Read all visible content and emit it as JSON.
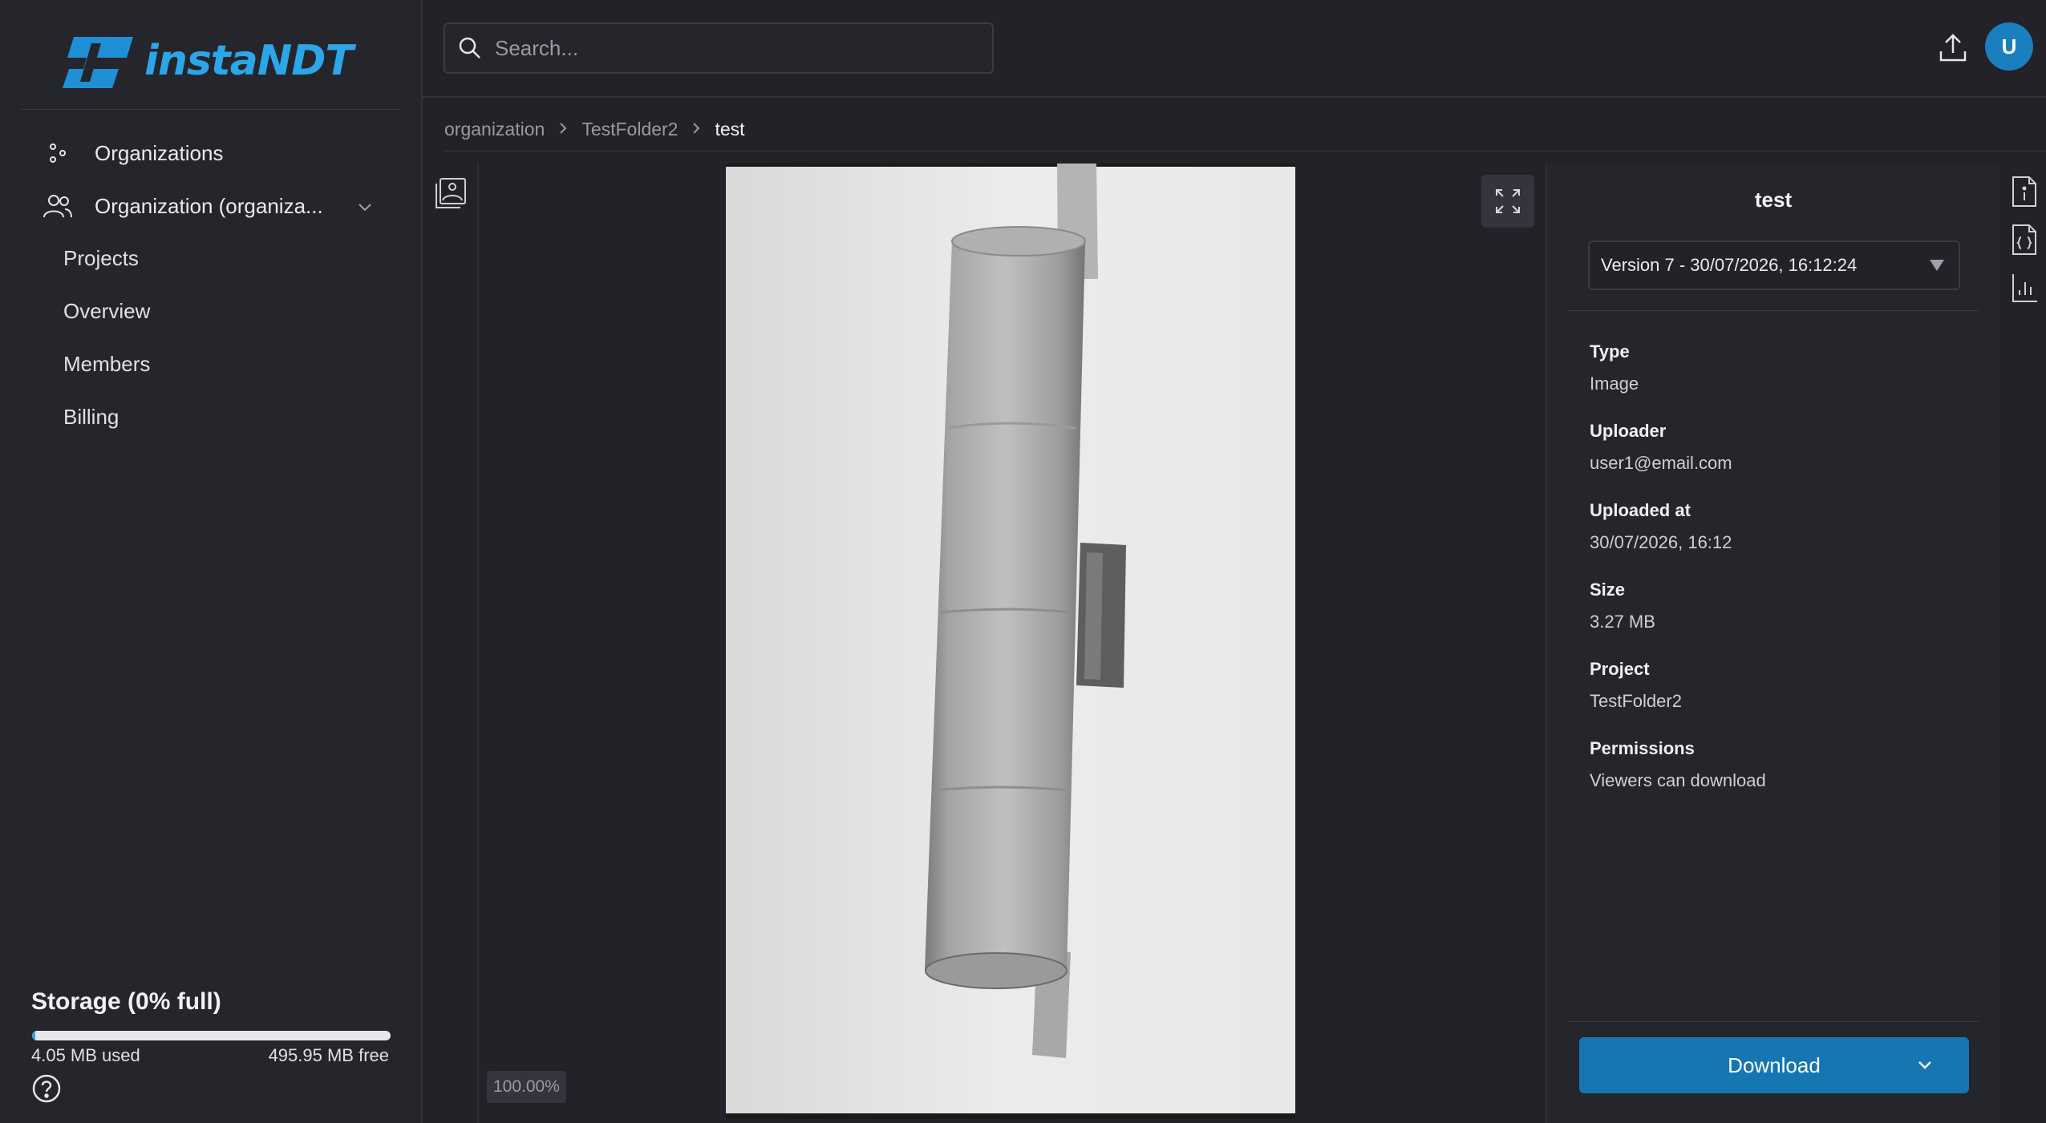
{
  "brand": {
    "name": "instaNDT"
  },
  "sidebar": {
    "nav": [
      {
        "label": "Organizations"
      },
      {
        "label": "Organization (organiza..."
      }
    ],
    "sub_items": [
      "Projects",
      "Overview",
      "Members",
      "Billing"
    ],
    "storage": {
      "title": "Storage (0% full)",
      "used": "4.05 MB used",
      "free": "495.95 MB free",
      "fraction_used": 0.008
    }
  },
  "topbar": {
    "search_placeholder": "Search...",
    "avatar_initial": "U"
  },
  "breadcrumb": [
    "organization",
    "TestFolder2",
    "test"
  ],
  "viewer": {
    "zoom": "100.00%"
  },
  "details": {
    "title": "test",
    "version": "Version 7 - 30/07/2026, 16:12:24",
    "fields": [
      {
        "label": "Type",
        "value": "Image"
      },
      {
        "label": "Uploader",
        "value": "user1@email.com"
      },
      {
        "label": "Uploaded at",
        "value": "30/07/2026, 16:12"
      },
      {
        "label": "Size",
        "value": "3.27 MB"
      },
      {
        "label": "Project",
        "value": "TestFolder2"
      },
      {
        "label": "Permissions",
        "value": "Viewers can download"
      }
    ],
    "download_label": "Download"
  },
  "colors": {
    "accent": "#1576b2",
    "brand": "#2ba6e8",
    "background": "#222228",
    "panel": "#25252c"
  }
}
